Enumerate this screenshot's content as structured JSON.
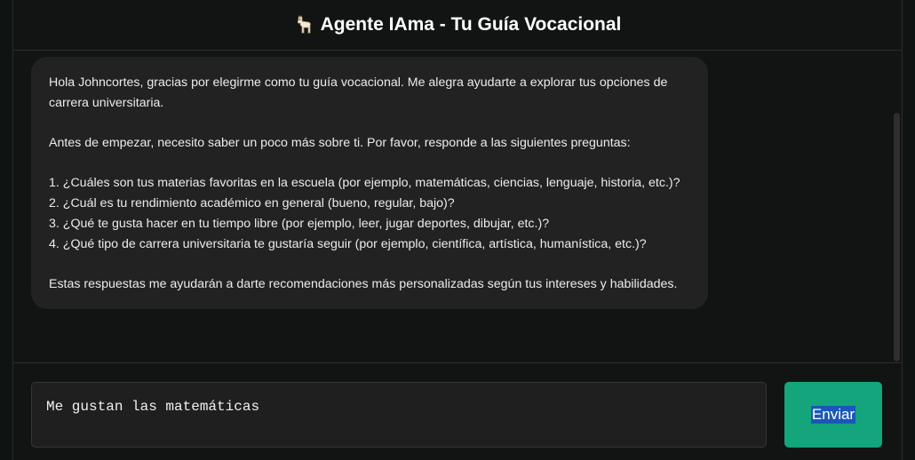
{
  "header": {
    "icon": "llama-icon",
    "title": "Agente IAma - Tu Guía Vocacional"
  },
  "chat": {
    "message": {
      "intro": "Hola Johncortes, gracias por elegirme como tu guía vocacional. Me alegra ayudarte a explorar tus opciones de carrera universitaria.",
      "before": "Antes de empezar, necesito saber un poco más sobre ti. Por favor, responde a las siguientes preguntas:",
      "questions": [
        "1. ¿Cuáles son tus materias favoritas en la escuela (por ejemplo, matemáticas, ciencias, lenguaje, historia, etc.)?",
        "2. ¿Cuál es tu rendimiento académico en general (bueno, regular, bajo)?",
        "3. ¿Qué te gusta hacer en tu tiempo libre (por ejemplo, leer, jugar deportes, dibujar, etc.)?",
        "4. ¿Qué tipo de carrera universitaria te gustaría seguir (por ejemplo, científica, artística, humanística, etc.)?"
      ],
      "closing": "Estas respuestas me ayudarán a darte recomendaciones más personalizadas según tus intereses y habilidades."
    }
  },
  "composer": {
    "input_value": "Me gustan las matemáticas",
    "send_label": "Enviar"
  },
  "colors": {
    "accent": "#14a57c",
    "background": "#121413",
    "bubble": "#222222"
  }
}
